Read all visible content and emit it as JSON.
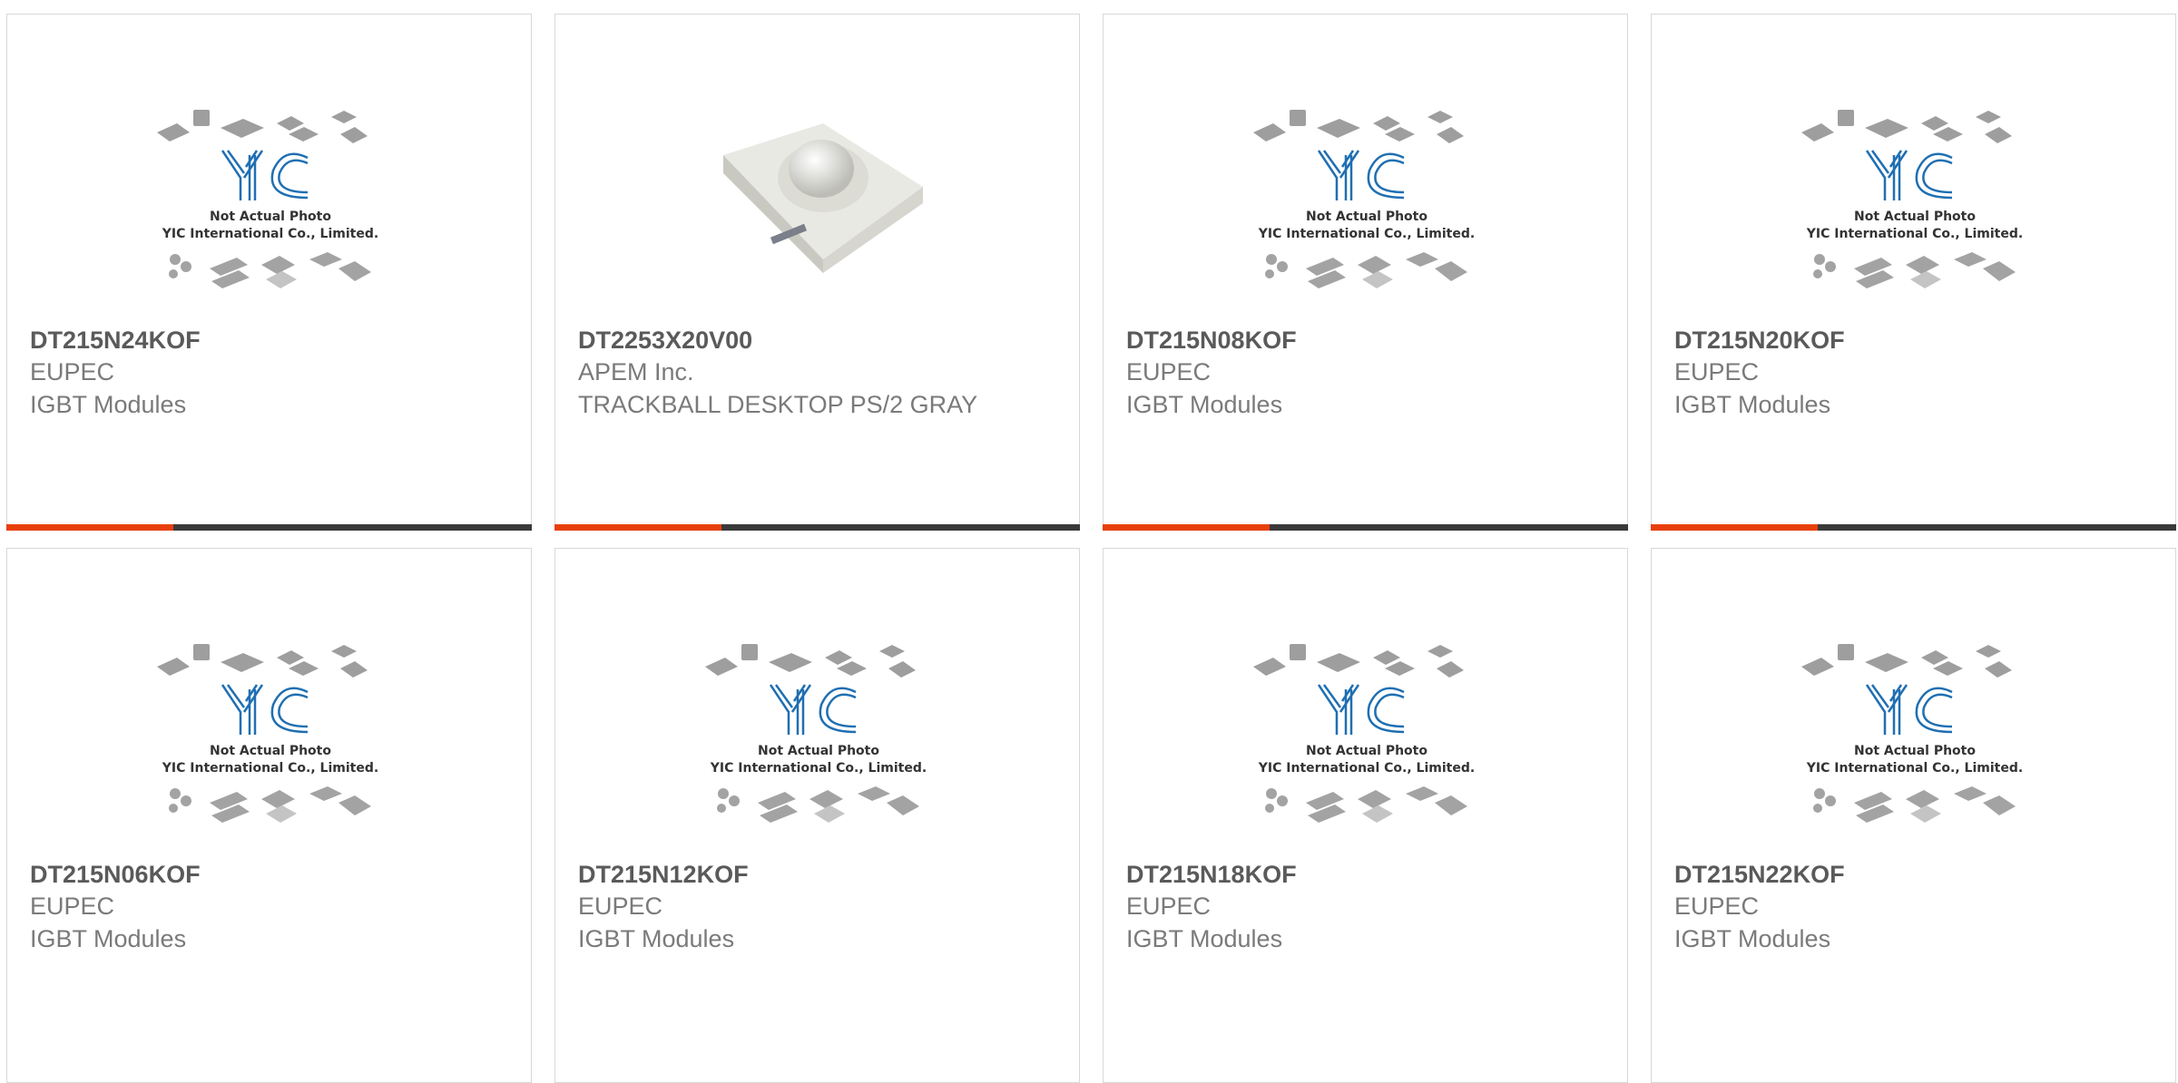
{
  "placeholder": {
    "logo": "YIC",
    "line1": "Not Actual Photo",
    "line2": "YIC International Co., Limited."
  },
  "colors": {
    "accent": "#e8400c",
    "bar": "#3a3a3a",
    "logo": "#1f6fb2"
  },
  "products": [
    {
      "pn": "DT215N24KOF",
      "maker": "EUPEC",
      "desc": "IGBT Modules",
      "image": "placeholder-logo",
      "accent_bar": true
    },
    {
      "pn": "DT2253X20V00",
      "maker": "APEM Inc.",
      "desc": "TRACKBALL DESKTOP PS/2 GRAY",
      "image": "trackball-photo",
      "accent_bar": true
    },
    {
      "pn": "DT215N08KOF",
      "maker": "EUPEC",
      "desc": "IGBT Modules",
      "image": "placeholder-logo",
      "accent_bar": true
    },
    {
      "pn": "DT215N20KOF",
      "maker": "EUPEC",
      "desc": "IGBT Modules",
      "image": "placeholder-logo",
      "accent_bar": true
    },
    {
      "pn": "DT215N06KOF",
      "maker": "EUPEC",
      "desc": "IGBT Modules",
      "image": "placeholder-logo",
      "accent_bar": false
    },
    {
      "pn": "DT215N12KOF",
      "maker": "EUPEC",
      "desc": "IGBT Modules",
      "image": "placeholder-logo",
      "accent_bar": false
    },
    {
      "pn": "DT215N18KOF",
      "maker": "EUPEC",
      "desc": "IGBT Modules",
      "image": "placeholder-logo",
      "accent_bar": false
    },
    {
      "pn": "DT215N22KOF",
      "maker": "EUPEC",
      "desc": "IGBT Modules",
      "image": "placeholder-logo",
      "accent_bar": false
    }
  ]
}
